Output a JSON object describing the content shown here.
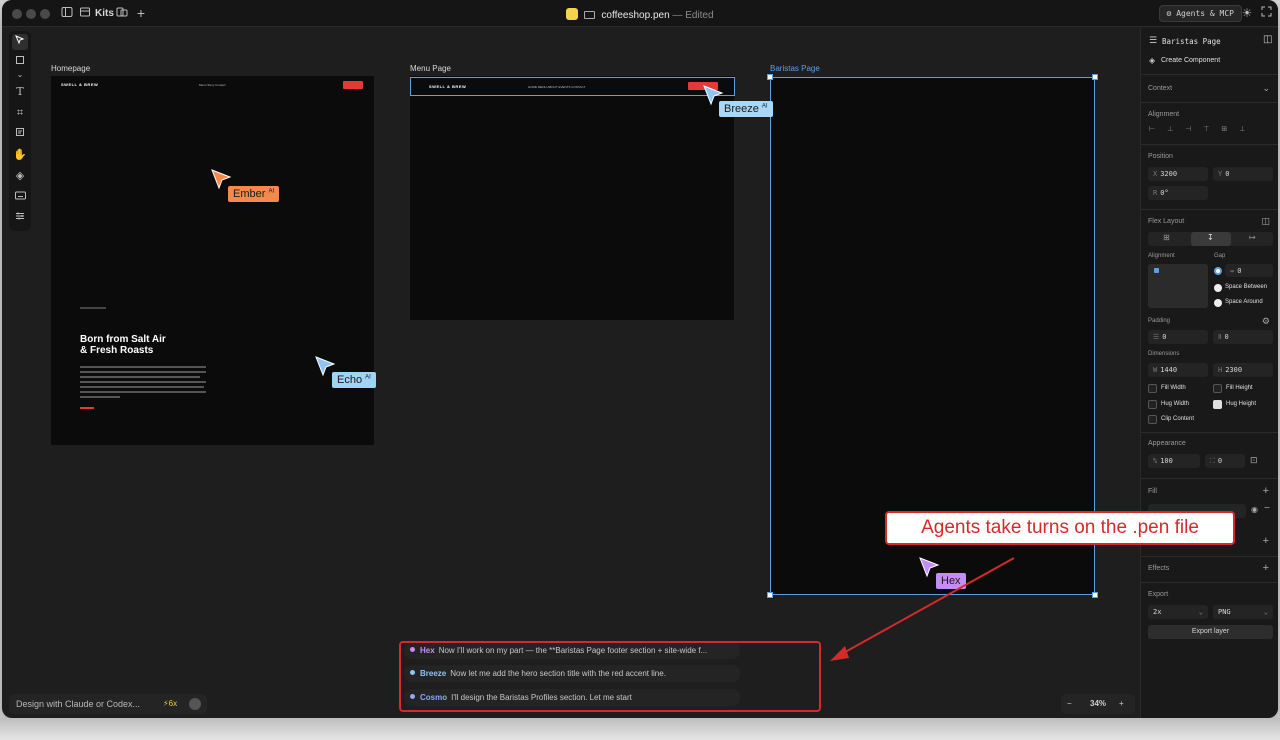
{
  "titlebar": {
    "kits_label": "Kits",
    "filename": "coffeeshop.pen",
    "status": "— Edited",
    "agents_label": "Agents & MCP"
  },
  "canvas": {
    "frames": {
      "homepage": "Homepage",
      "menu": "Menu Page",
      "baristas": "Baristas Page"
    },
    "homepage": {
      "brand": "SWELL & BREW",
      "nav_links": "Menu   Story   Contact",
      "hero_title_line1": "Born from Salt Air",
      "hero_title_line2": "& Fresh Roasts"
    },
    "menu": {
      "brand": "SWELL & BREW",
      "nav_links": "HOME    MENU    ABOUT    EVENTS    CONTACT"
    }
  },
  "agents": [
    {
      "name": "Ember",
      "suffix": "AI",
      "color": "#f5894c"
    },
    {
      "name": "Breeze",
      "suffix": "AI",
      "color": "#a8d8f5"
    },
    {
      "name": "Echo",
      "suffix": "AI",
      "color": "#9fd4f4"
    },
    {
      "name": "Hex",
      "suffix": "",
      "color": "#c68cf5"
    }
  ],
  "panel": {
    "selection": "Baristas Page",
    "create_component": "Create Component",
    "context": "Context",
    "alignment": "Alignment",
    "position": "Position",
    "x": "3200",
    "y": "0",
    "rotation": "0°",
    "flex_layout": "Flex Layout",
    "alignment_sub": "Alignment",
    "gap": "Gap",
    "gap_value": "0",
    "space_between": "Space Between",
    "space_around": "Space Around",
    "padding": "Padding",
    "padding_h": "0",
    "padding_v": "0",
    "dimensions": "Dimensions",
    "width": "1440",
    "height": "2300",
    "fill_width": "Fill Width",
    "fill_height": "Fill Height",
    "hug_width": "Hug Width",
    "hug_height": "Hug Height",
    "clip_content": "Clip Content",
    "appearance": "Appearance",
    "opacity": "100",
    "radius": "0",
    "fill": "Fill",
    "effects": "Effects",
    "export": "Export",
    "export_scale": "2x",
    "export_format": "PNG",
    "export_button": "Export layer"
  },
  "chat": [
    {
      "who": "Hex",
      "color": "#c68cf5",
      "msg": "Now I'll work on my part — the **Baristas Page footer section + site-wide f..."
    },
    {
      "who": "Breeze",
      "color": "#8fc4f5",
      "msg": "Now let me add the hero section title with the red accent line."
    },
    {
      "who": "Cosmo",
      "color": "#8fa8f5",
      "msg": "I'll design the Baristas Profiles section. Let me start"
    }
  ],
  "annotation": "Agents take turns on the .pen file",
  "bottom": {
    "prompt": "Design with Claude or Codex...",
    "count": "6x"
  },
  "zoom": "34%"
}
